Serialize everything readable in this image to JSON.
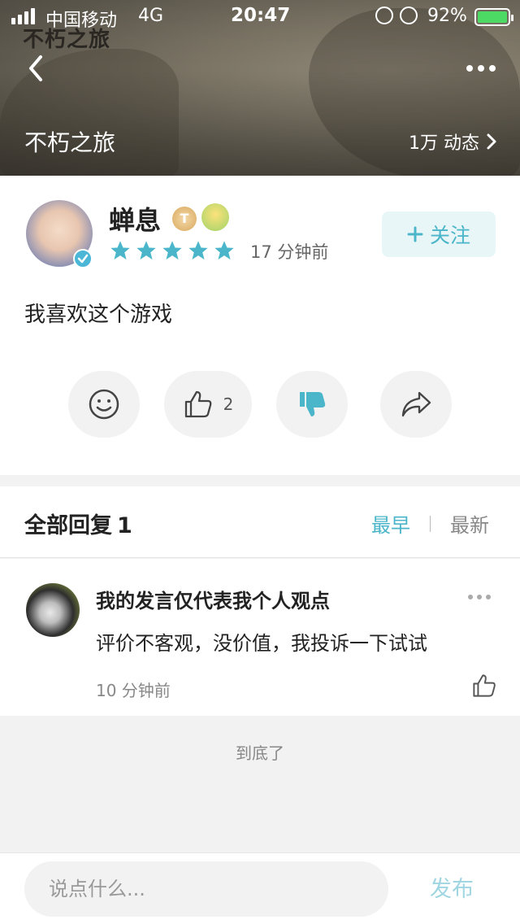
{
  "status_bar": {
    "carrier": "中国移动",
    "network": "4G",
    "time": "20:47",
    "battery_percent": "92%"
  },
  "banner": {
    "logo_text": "不朽之旅",
    "game_title": "不朽之旅",
    "posts_count": "1万 动态"
  },
  "post": {
    "username": "蝉息",
    "badge_text": "T",
    "rating_stars": 5,
    "time": "17 分钟前",
    "follow_label": "关注",
    "content": "我喜欢这个游戏",
    "like_count": "2"
  },
  "replies": {
    "title": "全部回复",
    "count": "1",
    "sort_earliest": "最早",
    "sort_latest": "最新",
    "items": [
      {
        "name": "我的发言仅代表我个人观点",
        "text": "评价不客观，没价值，我投诉一下试试",
        "time": "10 分钟前"
      }
    ]
  },
  "end_text": "到底了",
  "bottom_bar": {
    "input_placeholder": "说点什么...",
    "publish_label": "发布"
  },
  "colors": {
    "accent": "#4bb6c9",
    "star": "#4bb6c9",
    "battery": "#4cd964"
  }
}
